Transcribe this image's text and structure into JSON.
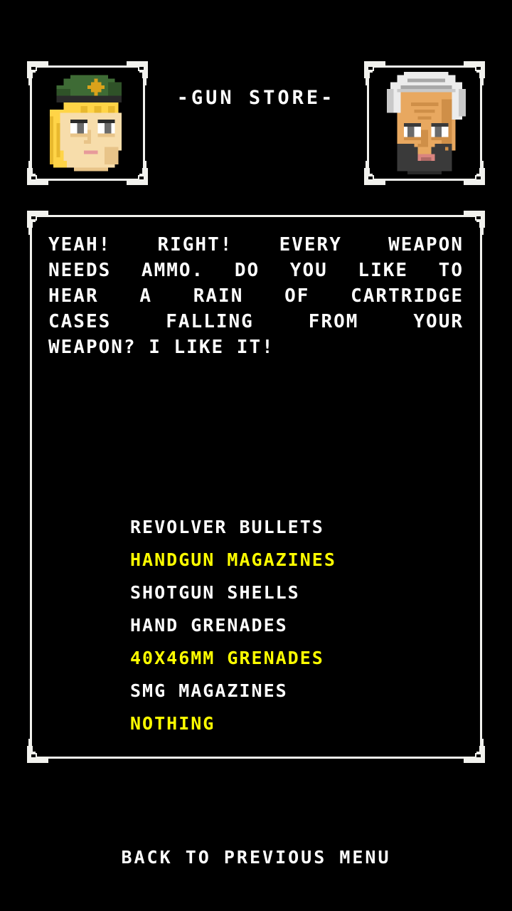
{
  "screen": {
    "title": "-GUN STORE-",
    "background_color": "#000000",
    "text_color": "#ffffff",
    "highlight_color": "#ffff00",
    "frame_color": "#f2f2ee"
  },
  "portraits": {
    "left": {
      "name": "player-soldier-portrait",
      "description": "blonde soldier with green beret",
      "colors": {
        "beret": "#3e6b35",
        "beret_shadow": "#2f5228",
        "insignia": "#d9a21b",
        "hair": "#ffd447",
        "hair_shadow": "#e8b92e",
        "skin": "#f7ddab",
        "skin_shadow": "#e8c489",
        "outline": "#2a2a2a",
        "eye_white": "#ffffff",
        "eye_iris": "#6b6b6b",
        "mouth": "#e79a9a"
      }
    },
    "right": {
      "name": "gun-dealer-portrait",
      "description": "bearded dealer with white turban",
      "colors": {
        "turban": "#ececec",
        "turban_shadow": "#c9c9c9",
        "turban_line": "#a8a8a8",
        "skin": "#e8a860",
        "skin_shadow": "#cf8f48",
        "beard": "#3a3a3a",
        "beard_shadow": "#2a2a2a",
        "outline": "#232323",
        "eye_white": "#ffffff",
        "eye_iris": "#6b6b6b",
        "mouth": "#d9847f"
      }
    }
  },
  "dialogue": {
    "lines": [
      "YEAH! RIGHT! EVERY WEAPON",
      "NEEDS AMMO. DO YOU LIKE TO",
      "HEAR A RAIN OF CARTRIDGE",
      "CASES FALLING FROM YOUR",
      "WEAPON? I LIKE IT!"
    ]
  },
  "menu": {
    "items": [
      {
        "label": "REVOLVER BULLETS",
        "selected": false
      },
      {
        "label": "HANDGUN MAGAZINES",
        "selected": true
      },
      {
        "label": "SHOTGUN SHELLS",
        "selected": false
      },
      {
        "label": "HAND GRENADES",
        "selected": false
      },
      {
        "label": "40X46MM GRENADES",
        "selected": true
      },
      {
        "label": "SMG MAGAZINES",
        "selected": false
      },
      {
        "label": "NOTHING",
        "selected": true
      }
    ]
  },
  "footer": {
    "back_label": "BACK TO PREVIOUS MENU"
  },
  "icons": {
    "corner": "revolver-icon"
  }
}
